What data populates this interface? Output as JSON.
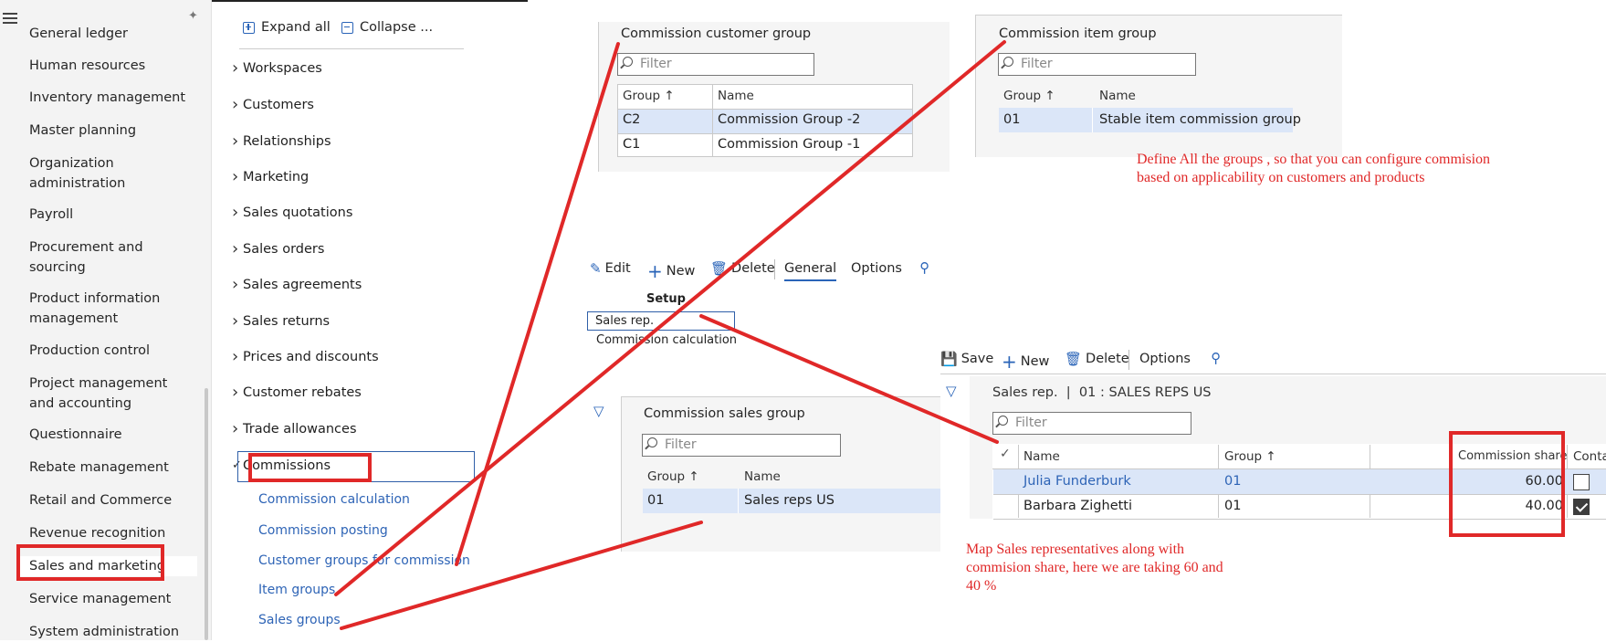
{
  "nav": {
    "items": [
      "General ledger",
      "Human resources",
      "Inventory management",
      "Master planning",
      "Organization administration",
      "Payroll",
      "Procurement and sourcing",
      "Product information management",
      "Production control",
      "Project management and accounting",
      "Questionnaire",
      "Rebate management",
      "Retail and Commerce",
      "Revenue recognition",
      "Sales and marketing",
      "Service management",
      "System administration"
    ],
    "active": "Sales and marketing"
  },
  "module": {
    "expand_all": "Expand all",
    "collapse": "Collapse ...",
    "menu": [
      "Workspaces",
      "Customers",
      "Relationships",
      "Marketing",
      "Sales quotations",
      "Sales orders",
      "Sales agreements",
      "Sales returns",
      "Prices and discounts",
      "Customer rebates",
      "Trade allowances",
      "Commissions"
    ],
    "sub": [
      "Commission calculation",
      "Commission posting",
      "Customer groups for commission",
      "Item groups",
      "Sales groups"
    ]
  },
  "customer_group": {
    "title": "Commission customer group",
    "filter_placeholder": "Filter",
    "col_group": "Group",
    "col_name": "Name",
    "rows": [
      {
        "group": "C2",
        "name": "Commission Group -2"
      },
      {
        "group": "C1",
        "name": "Commission Group -1"
      }
    ]
  },
  "item_group": {
    "title": "Commission item group",
    "filter_placeholder": "Filter",
    "col_group": "Group",
    "col_name": "Name",
    "rows": [
      {
        "group": "01",
        "name": "Stable item commission group"
      }
    ]
  },
  "note_groups": "Define All the groups , so that you can configure commision based on applicability on customers and products",
  "sales_group_bar": {
    "edit": "Edit",
    "new": "New",
    "delete": "Delete",
    "general": "General",
    "options": "Options",
    "setup": "Setup",
    "sales_rep": "Sales rep.",
    "commission_calc": "Commission calculation"
  },
  "sales_group": {
    "title": "Commission sales group",
    "filter_placeholder": "Filter",
    "col_group": "Group",
    "col_name": "Name",
    "rows": [
      {
        "group": "01",
        "name": "Sales reps US"
      }
    ]
  },
  "sales_rep": {
    "save": "Save",
    "new": "New",
    "delete": "Delete",
    "options": "Options",
    "caption": "Sales rep.  |  01 : SALES REPS US",
    "filter_placeholder": "Filter",
    "col_name": "Name",
    "col_group": "Group",
    "col_share": "Commission share",
    "col_contact": "Contac",
    "rows": [
      {
        "name": "Julia Funderburk",
        "group": "01",
        "share": "60.00",
        "contact": false
      },
      {
        "name": "Barbara Zighetti",
        "group": "01",
        "share": "40.00",
        "contact": true
      }
    ]
  },
  "note_reps": "Map Sales representatives along with commision share, here we are taking 60 and 40 %",
  "colors": {
    "accent": "#2a64b8",
    "annotation": "#e02828",
    "selected_row": "#dbe6f8"
  }
}
